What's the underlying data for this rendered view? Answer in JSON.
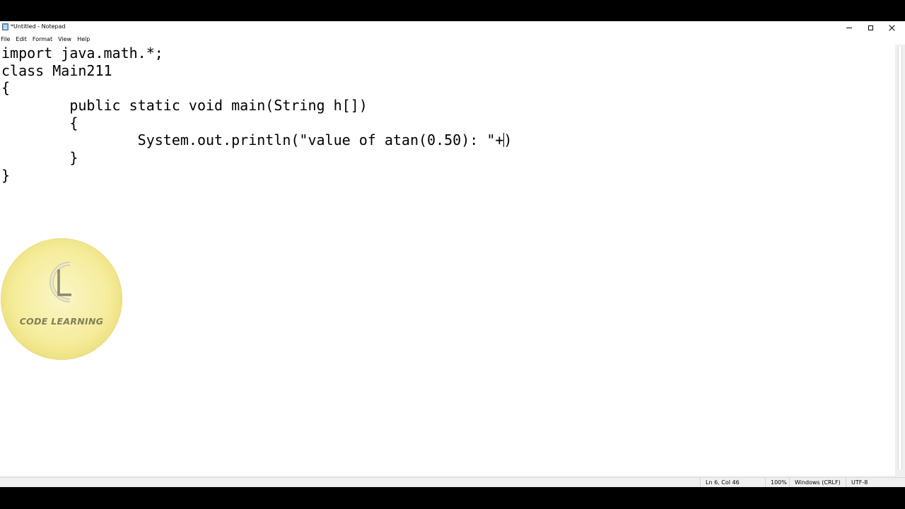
{
  "window": {
    "title": "*Untitled - Notepad",
    "icon": "notepad-icon",
    "controls": {
      "minimize": "minimize-icon",
      "maximize": "maximize-icon",
      "close": "close-icon"
    }
  },
  "menu": {
    "items": [
      {
        "label": "File"
      },
      {
        "label": "Edit"
      },
      {
        "label": "Format"
      },
      {
        "label": "View"
      },
      {
        "label": "Help"
      }
    ]
  },
  "editor": {
    "lines": [
      "import java.math.*;",
      "class Main211",
      "{",
      "        public static void main(String h[])",
      "        {",
      "                System.out.println(\"value of atan(0.50): \"+",
      "        }",
      "}"
    ],
    "caret_line_suffix": ")"
  },
  "status": {
    "position": "Ln 6, Col 46",
    "zoom": "100%",
    "line_ending": "Windows (CRLF)",
    "encoding": "UTF-8"
  },
  "watermark": {
    "text": "CODE LEARNING",
    "icon": "code-learning-logo-icon"
  },
  "colors": {
    "background": "#000000",
    "window": "#ffffff",
    "statusbar": "#f0f0f0",
    "logo": "#f5ec9a"
  }
}
